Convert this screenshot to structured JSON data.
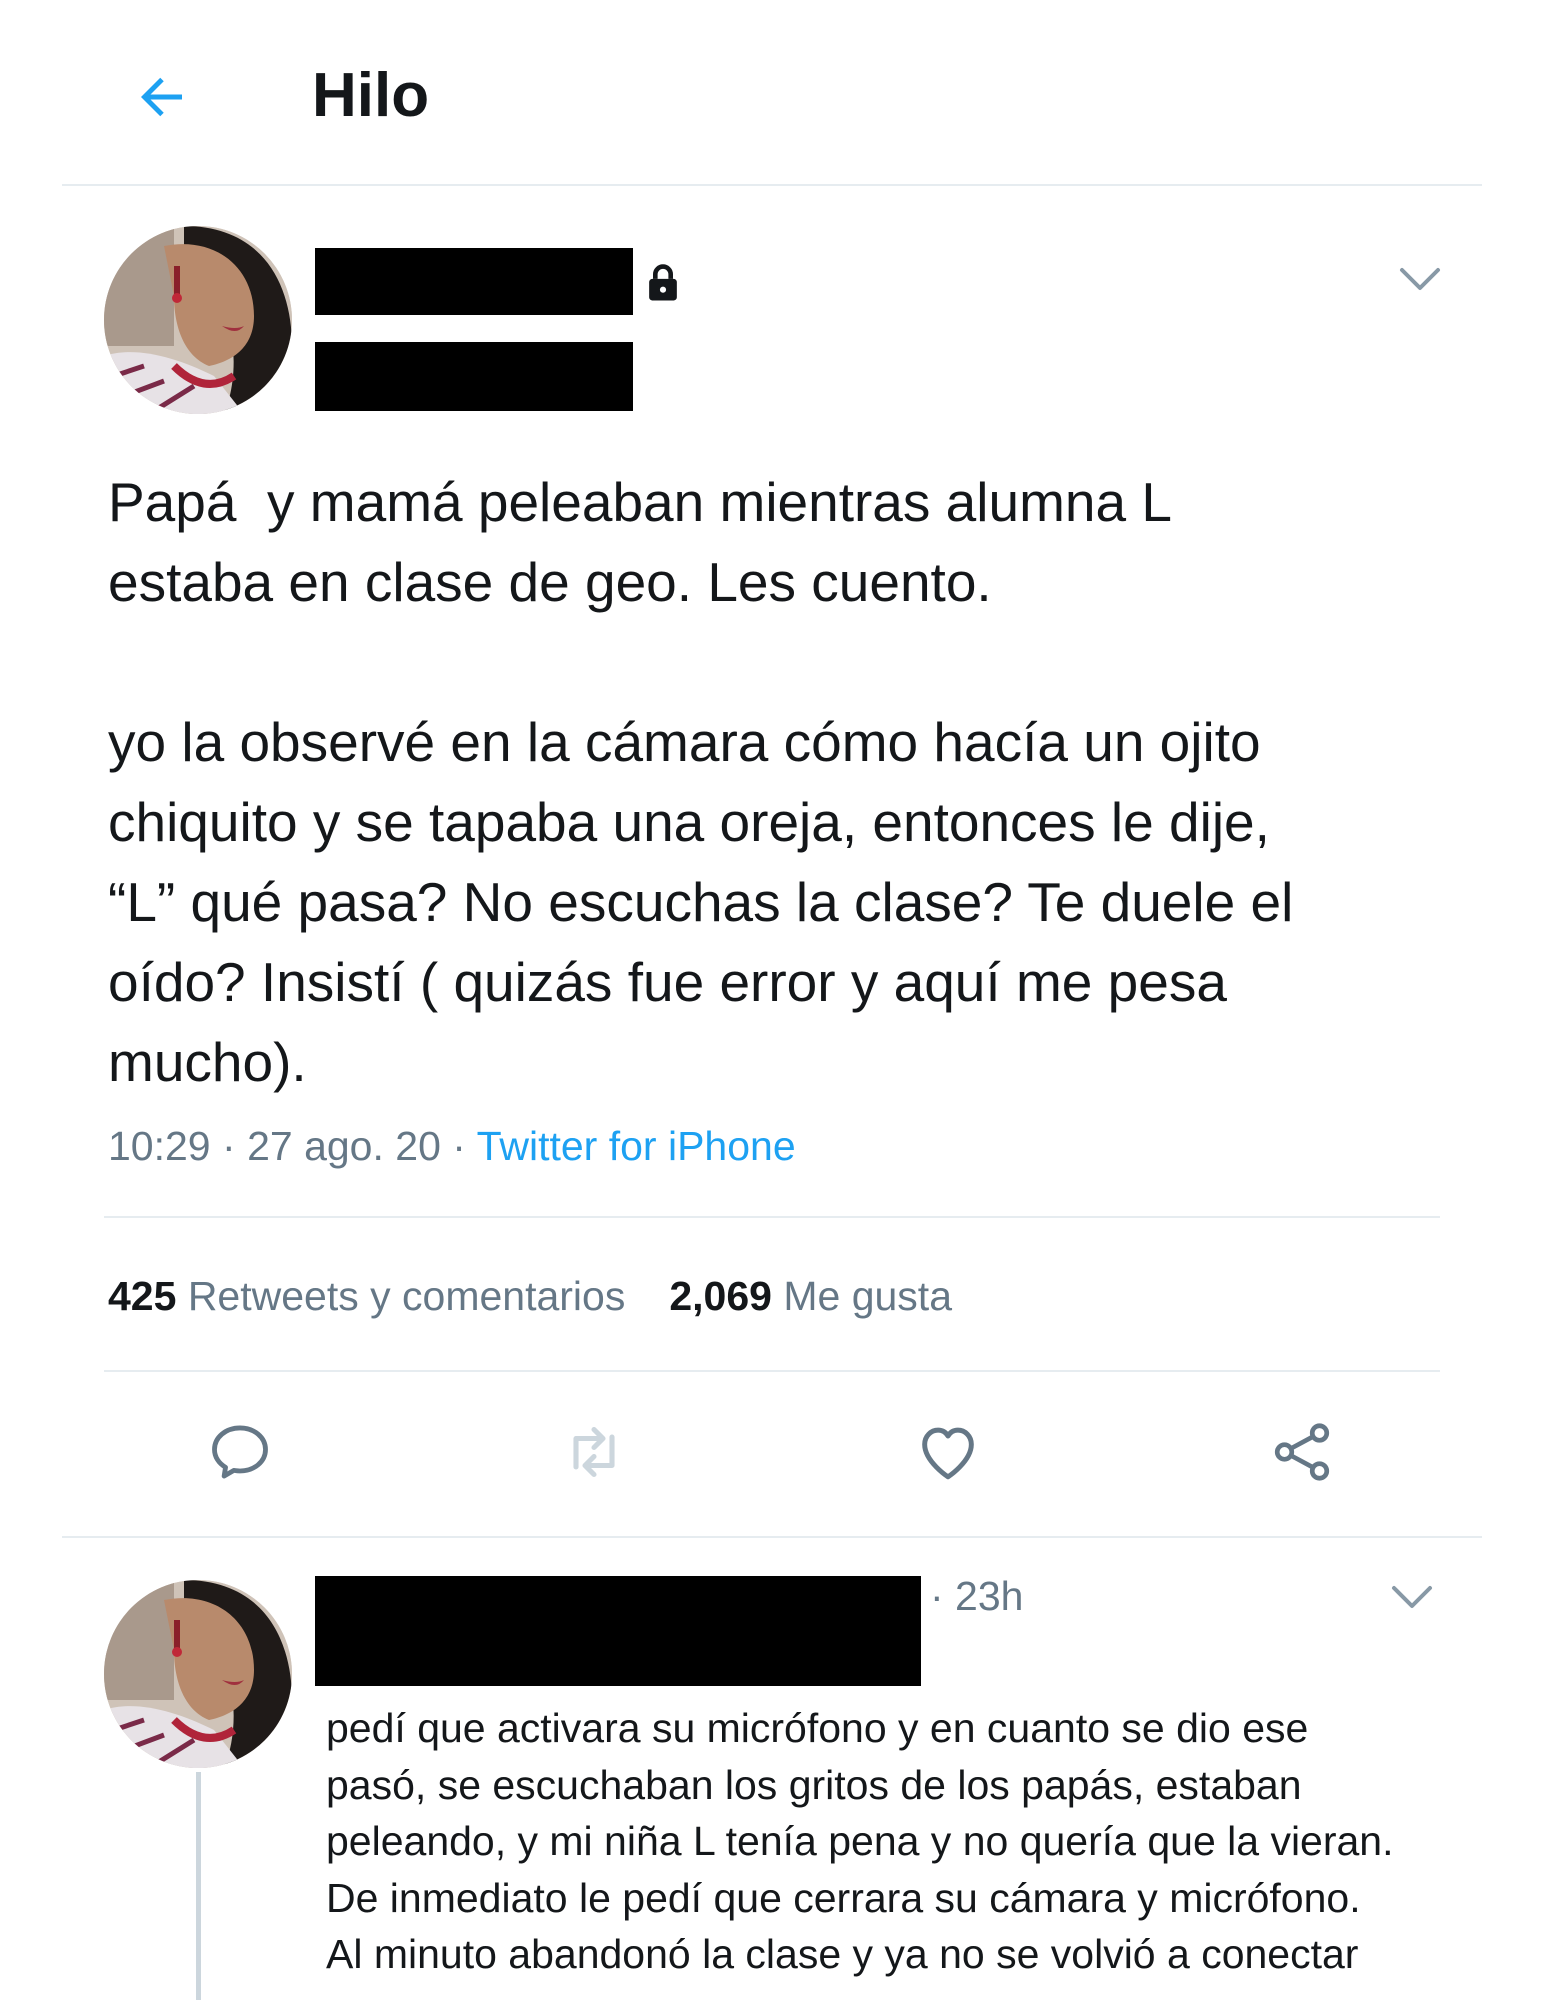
{
  "header": {
    "title": "Hilo",
    "back_icon": "arrow-left-icon"
  },
  "colors": {
    "accent": "#1da1f2",
    "text_primary": "#14171a",
    "text_secondary": "#657786",
    "divider": "#e6ecf0"
  },
  "main_tweet": {
    "author_protected": true,
    "text": "Papá  y mamá peleaban mientras alumna L\nestaba en clase de geo. Les cuento.\n\nyo la observé en la cámara cómo hacía un ojito\nchiquito y se tapaba una oreja, entonces le dije,\n“L” qué pasa? No escuchas la clase? Te duele el\noído? Insistí ( quizás fue error y aquí me pesa\nmucho).",
    "time": "10:29",
    "date": "27 ago. 20",
    "separator": "·",
    "source": "Twitter for iPhone",
    "stats": {
      "retweets_count": "425",
      "retweets_label": "Retweets y comentarios",
      "likes_count": "2,069",
      "likes_label": "Me gusta"
    },
    "actions": [
      "comment-icon",
      "retweet-icon",
      "heart-icon",
      "share-icon"
    ]
  },
  "reply_tweet": {
    "time": "· 23h",
    "text": "pedí que activara su micrófono y en cuanto se dio ese\npasó, se escuchaban los gritos de los papás, estaban\npeleando, y mi niña L tenía pena y no quería que la vieran.\nDe inmediato le pedí que cerrara su cámara y micrófono.\nAl minuto abandonó la clase y ya no se volvió a conectar"
  }
}
